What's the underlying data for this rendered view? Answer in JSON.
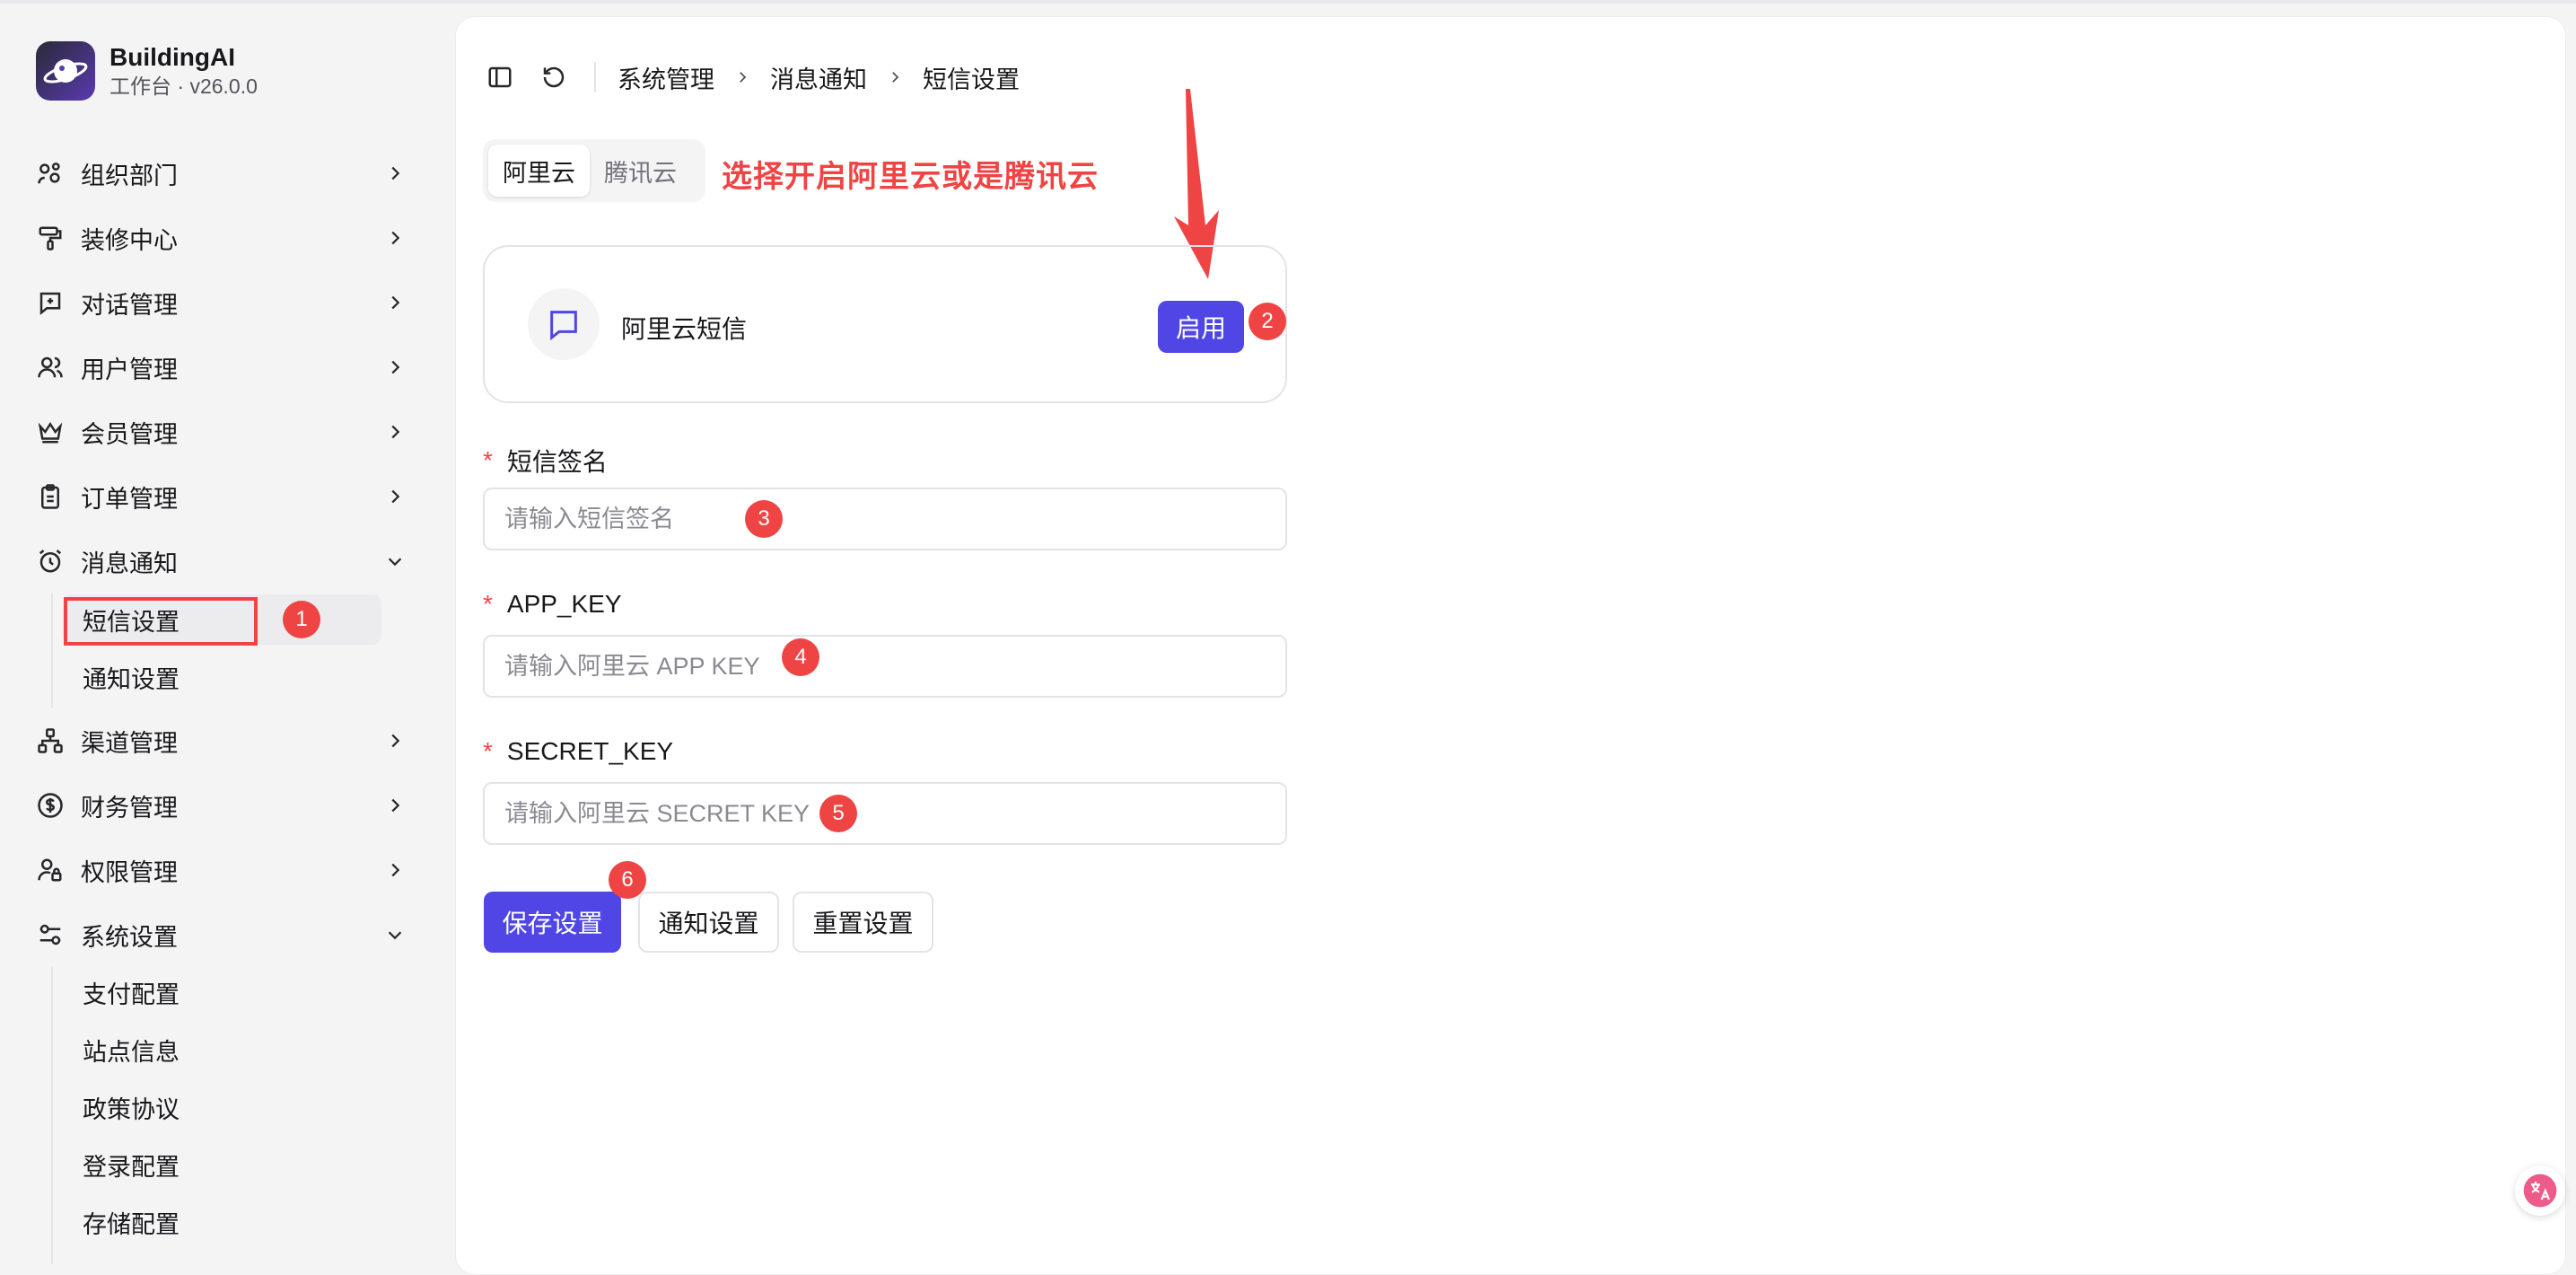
{
  "brand": {
    "name": "BuildingAI",
    "subtitle": "工作台 · v26.0.0"
  },
  "sidebar": {
    "items": [
      {
        "label": "组织部门",
        "icon": "org-icon"
      },
      {
        "label": "装修中心",
        "icon": "paint-roller-icon"
      },
      {
        "label": "对话管理",
        "icon": "chat-icon"
      },
      {
        "label": "用户管理",
        "icon": "users-icon"
      },
      {
        "label": "会员管理",
        "icon": "crown-icon"
      },
      {
        "label": "订单管理",
        "icon": "clipboard-icon"
      },
      {
        "label": "消息通知",
        "icon": "alarm-icon",
        "expanded": true
      },
      {
        "label": "渠道管理",
        "icon": "network-icon"
      },
      {
        "label": "财务管理",
        "icon": "dollar-icon"
      },
      {
        "label": "权限管理",
        "icon": "user-lock-icon"
      },
      {
        "label": "系统设置",
        "icon": "sliders-icon",
        "expanded": true
      }
    ],
    "notify_sub": [
      "短信设置",
      "通知设置"
    ],
    "system_sub": [
      "支付配置",
      "站点信息",
      "政策协议",
      "登录配置",
      "存储配置"
    ]
  },
  "breadcrumb": [
    "系统管理",
    "消息通知",
    "短信设置"
  ],
  "tabs": [
    "阿里云",
    "腾讯云"
  ],
  "annotation": {
    "text": "选择开启阿里云或是腾讯云"
  },
  "card": {
    "title": "阿里云短信",
    "enable_label": "启用"
  },
  "form": {
    "sign": {
      "label": "短信签名",
      "placeholder": "请输入短信签名"
    },
    "app_key": {
      "label": "APP_KEY",
      "placeholder": "请输入阿里云 APP KEY"
    },
    "secret_key": {
      "label": "SECRET_KEY",
      "placeholder": "请输入阿里云 SECRET KEY"
    },
    "required_mark": "*"
  },
  "buttons": {
    "save": "保存设置",
    "notify": "通知设置",
    "reset": "重置设置"
  },
  "badges": [
    "1",
    "2",
    "3",
    "4",
    "5",
    "6"
  ],
  "colors": {
    "accent": "#4f46e5",
    "annotation_red": "#ef4444"
  }
}
